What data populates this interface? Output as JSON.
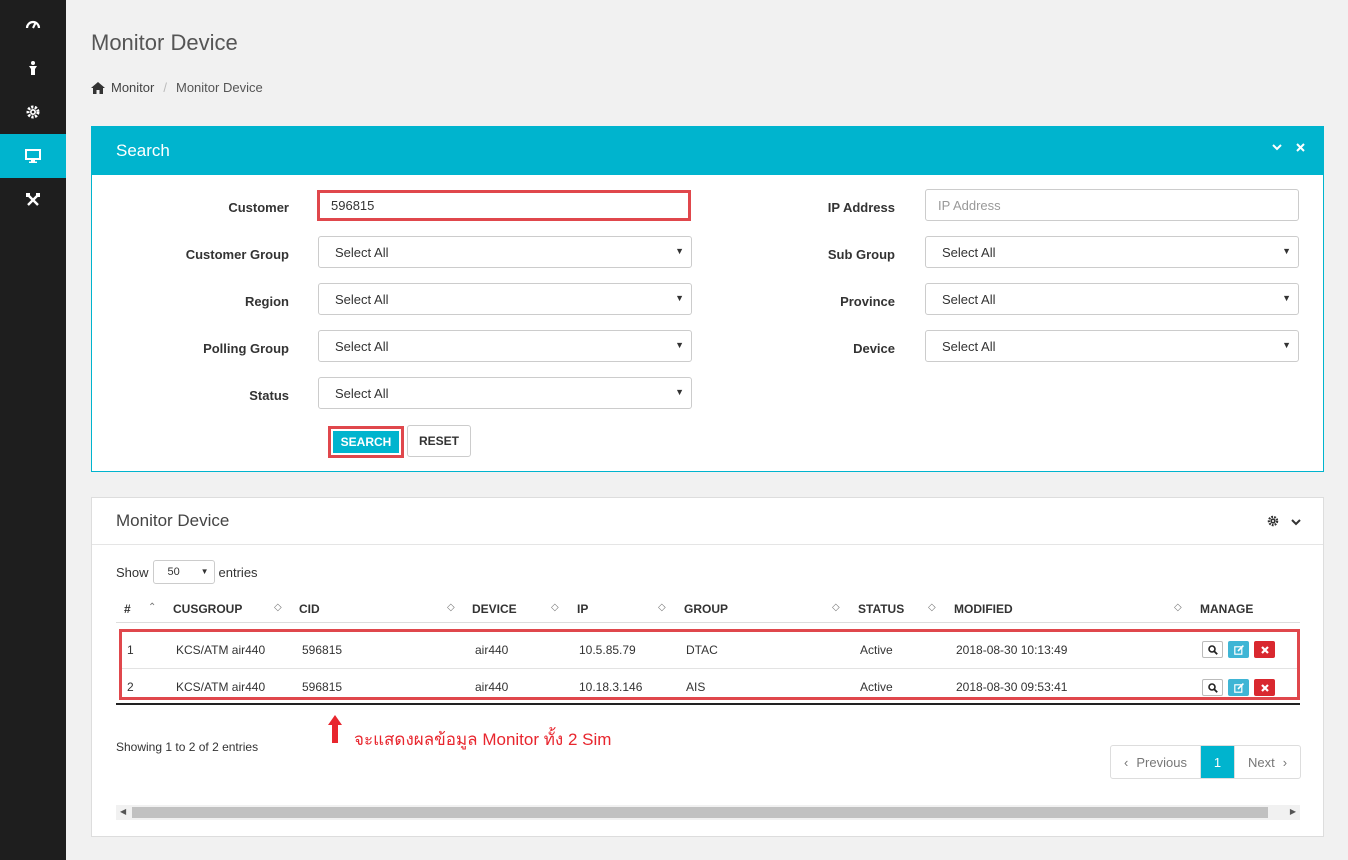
{
  "sidebar": {
    "items": [
      {
        "icon": "gauge-icon"
      },
      {
        "icon": "person-icon"
      },
      {
        "icon": "gear-icon"
      },
      {
        "icon": "monitor-icon",
        "active": true
      },
      {
        "icon": "tools-icon"
      }
    ]
  },
  "page": {
    "title": "Monitor Device",
    "breadcrumb": {
      "home": "Monitor",
      "current": "Monitor Device"
    }
  },
  "search": {
    "title": "Search",
    "fields": {
      "customer": {
        "label": "Customer",
        "value": "596815"
      },
      "customer_group": {
        "label": "Customer Group",
        "value": "Select All"
      },
      "region": {
        "label": "Region",
        "value": "Select All"
      },
      "polling_group": {
        "label": "Polling Group",
        "value": "Select All"
      },
      "status": {
        "label": "Status",
        "value": "Select All"
      },
      "ip_address": {
        "label": "IP Address",
        "placeholder": "IP Address"
      },
      "sub_group": {
        "label": "Sub Group",
        "value": "Select All"
      },
      "province": {
        "label": "Province",
        "value": "Select All"
      },
      "device": {
        "label": "Device",
        "value": "Select All"
      }
    },
    "search_button": "SEARCH",
    "reset_button": "RESET"
  },
  "results": {
    "title": "Monitor Device",
    "show_label": "Show",
    "page_length": "50",
    "entries_label": "entries",
    "columns": [
      "#",
      "CUSGROUP",
      "CID",
      "DEVICE",
      "IP",
      "GROUP",
      "STATUS",
      "MODIFIED",
      "MANAGE"
    ],
    "rows": [
      {
        "no": "1",
        "cusgroup": "KCS/ATM air440",
        "cid": "596815",
        "device": "air440",
        "ip": "10.5.85.79",
        "group": "DTAC",
        "status": "Active",
        "modified": "2018-08-30 10:13:49"
      },
      {
        "no": "2",
        "cusgroup": "KCS/ATM air440",
        "cid": "596815",
        "device": "air440",
        "ip": "10.18.3.146",
        "group": "AIS",
        "status": "Active",
        "modified": "2018-08-30 09:53:41"
      }
    ],
    "info": "Showing 1 to 2 of 2 entries",
    "annotation": "จะแสดงผลข้อมูล Monitor ทั้ง 2 Sim",
    "pagination": {
      "previous": "Previous",
      "current": "1",
      "next": "Next"
    }
  },
  "colors": {
    "accent": "#00b4ce",
    "highlight": "#e0474c",
    "sidebar": "#1e1e1e",
    "danger": "#d9282f",
    "info": "#3fb5d5"
  }
}
